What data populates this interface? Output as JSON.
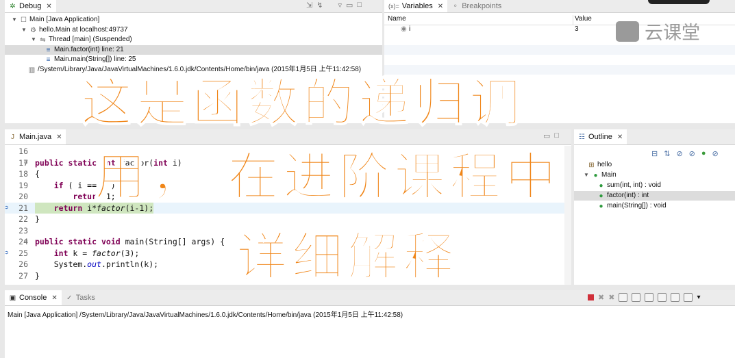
{
  "debug": {
    "tab_label": "Debug",
    "tree": [
      {
        "label": "Main [Java Application]",
        "icon": "java-app-icon"
      },
      {
        "label": "hello.Main at localhost:49737",
        "icon": "debug-target-icon"
      },
      {
        "label": "Thread [main] (Suspended)",
        "icon": "thread-suspended-icon"
      },
      {
        "label": "Main.factor(int) line: 21",
        "icon": "stack-frame-icon",
        "selected": true
      },
      {
        "label": "Main.main(String[]) line: 25",
        "icon": "stack-frame-icon"
      },
      {
        "label": "/System/Library/Java/JavaVirtualMachines/1.6.0.jdk/Contents/Home/bin/java (2015年1月5日 上午11:42:58)",
        "icon": "process-icon"
      }
    ]
  },
  "variables": {
    "tab_label": "Variables",
    "tab_prefix": "(x)=",
    "breakpoints_label": "Breakpoints",
    "columns": [
      "Name",
      "Value"
    ],
    "rows": [
      {
        "name": "i",
        "value": "3"
      }
    ]
  },
  "watermark": {
    "text": "云课堂"
  },
  "editor": {
    "tab_label": "Main.java",
    "lines": [
      {
        "n": "16",
        "html": ""
      },
      {
        "n": "17",
        "html": "<span class='kw'>public</span> <span class='kw'>static</span> <span class='kw'>int</span> factor(<span class='kw'>int</span> i)"
      },
      {
        "n": "18",
        "html": "{"
      },
      {
        "n": "19",
        "html": "    <span class='kw'>if</span> ( i == 1 )"
      },
      {
        "n": "20",
        "html": "        <span class='kw'>return</span> 1;"
      },
      {
        "n": "21",
        "html": "    <span class='kw'>return</span> i*<span class='it'>factor</span>(i-1);"
      },
      {
        "n": "22",
        "html": "}"
      },
      {
        "n": "23",
        "html": ""
      },
      {
        "n": "24",
        "html": "<span class='kw'>public</span> <span class='kw'>static</span> <span class='kw'>void</span> main(String[] args) {"
      },
      {
        "n": "25",
        "html": "    <span class='kw'>int</span> k = <span class='it'>factor</span>(3);"
      },
      {
        "n": "26",
        "html": "    System.<span class='fd'>out</span>.println(k);"
      },
      {
        "n": "27",
        "html": "}"
      }
    ]
  },
  "outline": {
    "tab_label": "Outline",
    "items": [
      {
        "label": "hello",
        "icon": "package-icon"
      },
      {
        "label": "Main",
        "icon": "class-icon"
      },
      {
        "label": "sum(int, int) : void",
        "icon": "method-icon"
      },
      {
        "label": "factor(int) : int",
        "icon": "method-icon"
      },
      {
        "label": "main(String[]) : void",
        "icon": "method-icon"
      }
    ]
  },
  "console": {
    "tab_label": "Console",
    "tasks_label": "Tasks",
    "line": "Main [Java Application] /System/Library/Java/JavaVirtualMachines/1.6.0.jdk/Contents/Home/bin/java (2015年1月5日 上午11:42:58)"
  },
  "overlay": {
    "line1": "这是函数的递归调",
    "line2": "用， 在进阶课程中",
    "line3": "详细解释",
    "color": "#f08619"
  }
}
